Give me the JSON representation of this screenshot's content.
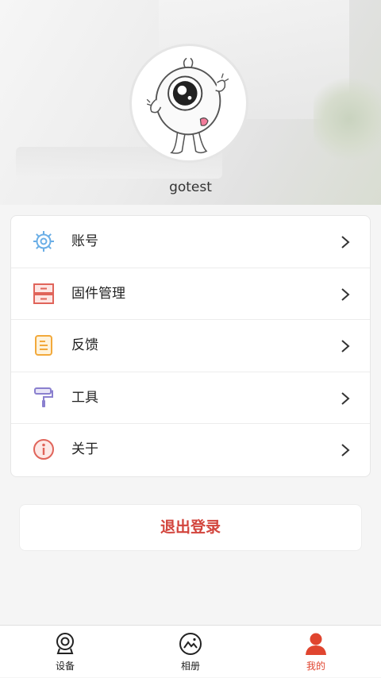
{
  "profile": {
    "username": "gotest"
  },
  "menu": {
    "items": [
      {
        "label": "账号",
        "icon": "gear-icon"
      },
      {
        "label": "固件管理",
        "icon": "drawer-icon"
      },
      {
        "label": "反馈",
        "icon": "document-icon"
      },
      {
        "label": "工具",
        "icon": "paint-roller-icon"
      },
      {
        "label": "关于",
        "icon": "info-icon"
      }
    ]
  },
  "logout": {
    "label": "退出登录"
  },
  "tabbar": {
    "tabs": [
      {
        "label": "设备",
        "icon": "camera-icon"
      },
      {
        "label": "相册",
        "icon": "album-icon"
      },
      {
        "label": "我的",
        "icon": "person-icon",
        "active": true
      }
    ]
  },
  "colors": {
    "accent": "#e0452f",
    "logout_text": "#d2443c"
  }
}
